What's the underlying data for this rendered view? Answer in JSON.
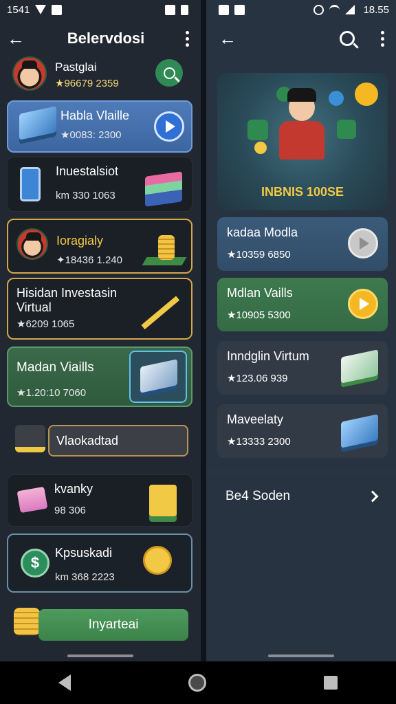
{
  "status_left": {
    "time": "1541"
  },
  "status_right": {
    "time": "18.55"
  },
  "left": {
    "title": "Belervdosi",
    "profile": {
      "name": "Pastglai",
      "stats": "★96679 2359"
    },
    "cards": [
      {
        "title": "Habla Vlaille",
        "stats": "★0083: 2300"
      },
      {
        "title": "Inuestalsiot",
        "stats": "km 330 1063"
      },
      {
        "title": "Ioragialy",
        "stats": "✦18436 1.240"
      },
      {
        "title": "Hisidan Investasin Virtual",
        "stats": "★6209 1065"
      },
      {
        "title": "Madan Viaills",
        "stats": "★1.20:10 7060"
      },
      {
        "title": "Vlaokadtad"
      },
      {
        "title": "kvanky",
        "stats": "98 306"
      },
      {
        "title": "Kpsuskadi",
        "stats": "km 368 2223"
      },
      {
        "title": "Inyarteai"
      }
    ]
  },
  "right": {
    "hero_title": "INBNIS 100SE",
    "cards": [
      {
        "title": "kadaa Modla",
        "stats": "★10359 6850"
      },
      {
        "title": "Mdlan Vaills",
        "stats": "★10905 5300"
      },
      {
        "title": "Inndglin Virtum",
        "stats": "★123.06 939"
      },
      {
        "title": "Maveelaty",
        "stats": "★13333 2300"
      }
    ],
    "see_all": "Be4 Soden"
  }
}
